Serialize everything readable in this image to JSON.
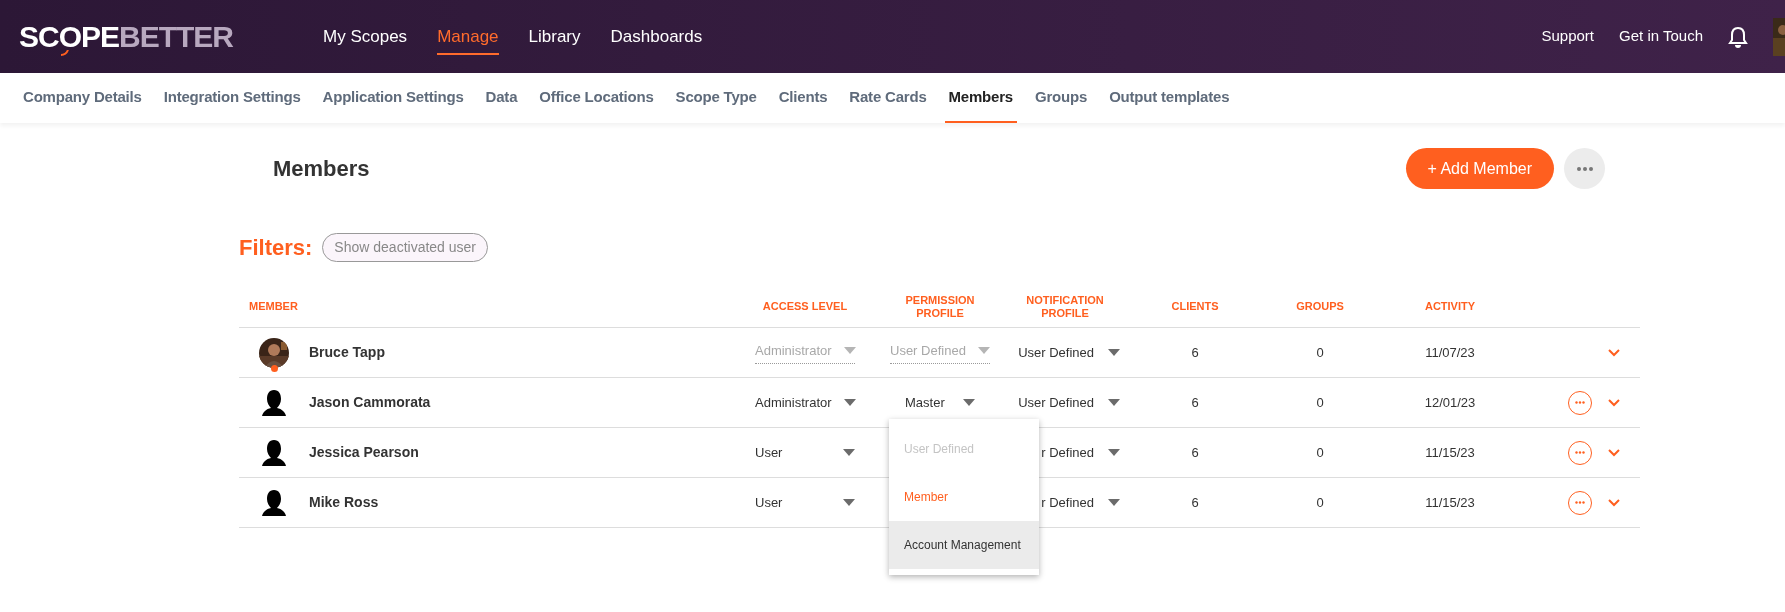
{
  "header": {
    "logo": {
      "primary": "SCOPE",
      "secondary": "BETTER"
    },
    "nav": [
      {
        "label": "My Scopes",
        "selected": false
      },
      {
        "label": "Manage",
        "selected": true
      },
      {
        "label": "Library",
        "selected": false
      },
      {
        "label": "Dashboards",
        "selected": false
      }
    ],
    "links": [
      "Support",
      "Get in Touch"
    ]
  },
  "subnav": [
    {
      "label": "Company Details",
      "selected": false
    },
    {
      "label": "Integration Settings",
      "selected": false
    },
    {
      "label": "Application Settings",
      "selected": false
    },
    {
      "label": "Data",
      "selected": false
    },
    {
      "label": "Office Locations",
      "selected": false
    },
    {
      "label": "Scope Type",
      "selected": false
    },
    {
      "label": "Clients",
      "selected": false
    },
    {
      "label": "Rate Cards",
      "selected": false
    },
    {
      "label": "Members",
      "selected": true
    },
    {
      "label": "Groups",
      "selected": false
    },
    {
      "label": "Output templates",
      "selected": false
    }
  ],
  "page": {
    "title": "Members",
    "add_button": "+ Add Member"
  },
  "filters": {
    "label": "Filters:",
    "chips": [
      {
        "label": "Show deactivated user",
        "selected": false
      }
    ]
  },
  "table": {
    "columns": [
      "MEMBER",
      "ACCESS LEVEL",
      "PERMISSION PROFILE",
      "NOTIFICATION PROFILE",
      "CLIENTS",
      "GROUPS",
      "ACTIVITY"
    ],
    "rows": [
      {
        "name": "Bruce Tapp",
        "online": true,
        "access": {
          "value": "Administrator",
          "disabled": true
        },
        "permission": {
          "value": "User Defined",
          "disabled": true
        },
        "notification": "User Defined",
        "clients": "6",
        "groups": "0",
        "activity": "11/07/23",
        "has_actions": false
      },
      {
        "name": "Jason Cammorata",
        "avatar": {
          "kind": "silhouette"
        },
        "online": false,
        "access": {
          "value": "Administrator",
          "disabled": false
        },
        "permission": {
          "value": "Master",
          "disabled": false,
          "menu": [
            {
              "label": "User Defined",
              "disabled": true,
              "selected": false,
              "highlighted": false
            },
            {
              "label": "Member",
              "disabled": false,
              "selected": true,
              "highlighted": false
            },
            {
              "label": "Account Management",
              "disabled": false,
              "selected": false,
              "highlighted": true
            }
          ]
        },
        "notification": "User Defined",
        "clients": "6",
        "groups": "0",
        "activity": "12/01/23",
        "has_actions": true
      },
      {
        "name": "Jessica Pearson",
        "avatar": {
          "kind": "silhouette"
        },
        "online": false,
        "access": {
          "value": "User",
          "disabled": false
        },
        "notification": "r Defined",
        "clients": "6",
        "groups": "0",
        "activity": "11/15/23",
        "has_actions": true
      },
      {
        "name": "Mike Ross",
        "avatar": {
          "kind": "silhouette"
        },
        "online": false,
        "access": {
          "value": "User",
          "disabled": false
        },
        "notification": "r Defined",
        "clients": "6",
        "groups": "0",
        "activity": "11/15/23",
        "has_actions": true
      }
    ]
  }
}
